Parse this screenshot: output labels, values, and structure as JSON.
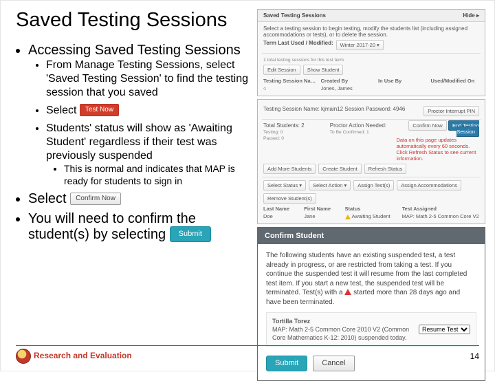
{
  "title": "Saved Testing Sessions",
  "bullets": {
    "b1": "Accessing Saved Testing Sessions",
    "b1a": "From Manage Testing Sessions, select 'Saved Testing Session' to find the testing session that you saved",
    "b1b_pre": "Select",
    "b1b_btn": "Test Now",
    "b1c": "Students' status will show as 'Awaiting Student' regardless if their test was previously suspended",
    "b1c1": "This is normal and indicates that MAP is ready for students to sign in",
    "b2_pre": "Select",
    "b2_btn": "Confirm Now",
    "b3_pre": "You will need to confirm the student(s) by selecting",
    "b3_btn": "Submit"
  },
  "shot1": {
    "title": "Saved Testing Sessions",
    "hide": "Hide ▸",
    "desc": "Select a testing session to begin testing, modify the students list (including assigned accommodations or tests), or to delete the session.",
    "term": "Term Last Used / Modified:",
    "termval": "Winter 2017-20  ▾",
    "found": "1 total testing sessions for this test term.",
    "cols": {
      "c1": "Testing Session Name",
      "c2": "Created By",
      "c3": "In Use By",
      "c4": "Used/Modified On"
    },
    "row": {
      "r2": "Jones, James"
    },
    "actions": {
      "a1": "Edit Session",
      "a2": "Show Student"
    }
  },
  "shot2": {
    "session": "Testing Session Name:  kjmain12   Session Password: 4946",
    "proctor": "Proctor Interrupt PIN",
    "left": {
      "l1": "Total Students: 2",
      "l2": "Testing: 0",
      "l3": "Paused: 0"
    },
    "mid": {
      "m1": "Proctor Action Needed:",
      "m2": "To Be Confirmed: 1"
    },
    "confirm": "Confirm Now",
    "end": "End Testing Session",
    "note": "Data on this page updates automatically every 60 seconds. Click Refresh Status to see current information.",
    "btns": {
      "b1": "Add More Students",
      "b2": "Create Student",
      "b3": "Refresh Status"
    },
    "toolbar": {
      "t1": "Select Status ▾",
      "t2": "Select Action ▾",
      "t3": "Assign Test(s)",
      "t4": "Assign Accommodations",
      "t5": "Remove Student(s)"
    },
    "hdr": {
      "h1": "Last Name",
      "h2": "First Name",
      "h3": "Status",
      "h4": "Test Assigned"
    },
    "rows": {
      "r1a": "Doe",
      "r1b": "Jane",
      "r1c": "Awaiting Student",
      "r1d": "MAP: Math 2-5 Common Core V2"
    }
  },
  "dialog": {
    "title": "Confirm Student",
    "p1_a": "The following students have an existing suspended test, a test already in progress, or are restricted from taking a test. If you continue the suspended test it will resume from the last completed test item. If you start a new test, the suspended test will be terminated. Test(s) with a ",
    "p1_b": " started more than 28 days ago and have been terminated.",
    "student_name": "Tortilla Torez",
    "student_info": "MAP: Math 2-5 Common Core 2010 V2 (Common Core Mathematics K-12: 2010) suspended today.",
    "resume": "Resume Test",
    "submit": "Submit",
    "cancel": "Cancel"
  },
  "footer": {
    "brand": "Research and Evaluation",
    "page": "14"
  }
}
